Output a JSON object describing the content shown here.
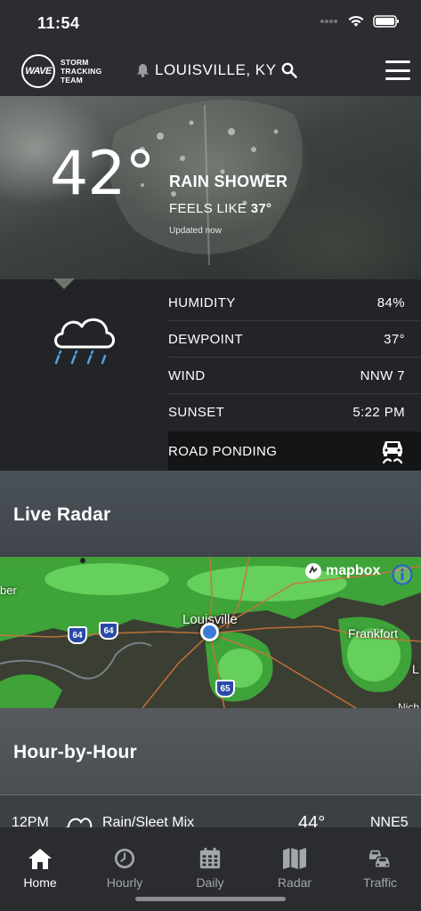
{
  "status_bar": {
    "time": "11:54"
  },
  "header": {
    "logo_badge": "WAVE",
    "logo_lines": [
      "STORM",
      "TRACKING",
      "TEAM"
    ],
    "location": "LOUISVILLE, KY"
  },
  "current": {
    "temperature": "42°",
    "condition": "RAIN SHOWER",
    "feels_like_label": "FEELS LIKE",
    "feels_like_value": "37°",
    "updated": "Updated now"
  },
  "details": {
    "rows": [
      {
        "label": "HUMIDITY",
        "value": "84%"
      },
      {
        "label": "DEWPOINT",
        "value": "37°"
      },
      {
        "label": "WIND",
        "value": "NNW 7"
      },
      {
        "label": "SUNSET",
        "value": "5:22 PM"
      }
    ],
    "alert_label": "ROAD PONDING"
  },
  "radar": {
    "title": "Live Radar",
    "attribution": "mapbox",
    "places": {
      "city": "Louisville",
      "frankfort": "Frankfort",
      "west_edge": "ber",
      "east_edge_l": "L",
      "east_edge_n": "Nich"
    },
    "shields": [
      "64",
      "64",
      "65"
    ]
  },
  "hourly": {
    "title": "Hour-by-Hour",
    "first_row": {
      "time": "12PM",
      "condition": "Rain/Sleet Mix",
      "temp": "44°",
      "wind": "NNE5"
    }
  },
  "tabs": [
    {
      "label": "Home",
      "icon": "home-icon"
    },
    {
      "label": "Hourly",
      "icon": "clock-icon"
    },
    {
      "label": "Daily",
      "icon": "calendar-icon"
    },
    {
      "label": "Radar",
      "icon": "map-icon"
    },
    {
      "label": "Traffic",
      "icon": "traffic-icon"
    }
  ],
  "colors": {
    "accent_blue": "#3a7bd5",
    "radar_green": "#4fc04a",
    "road_orange": "#c9733d"
  }
}
